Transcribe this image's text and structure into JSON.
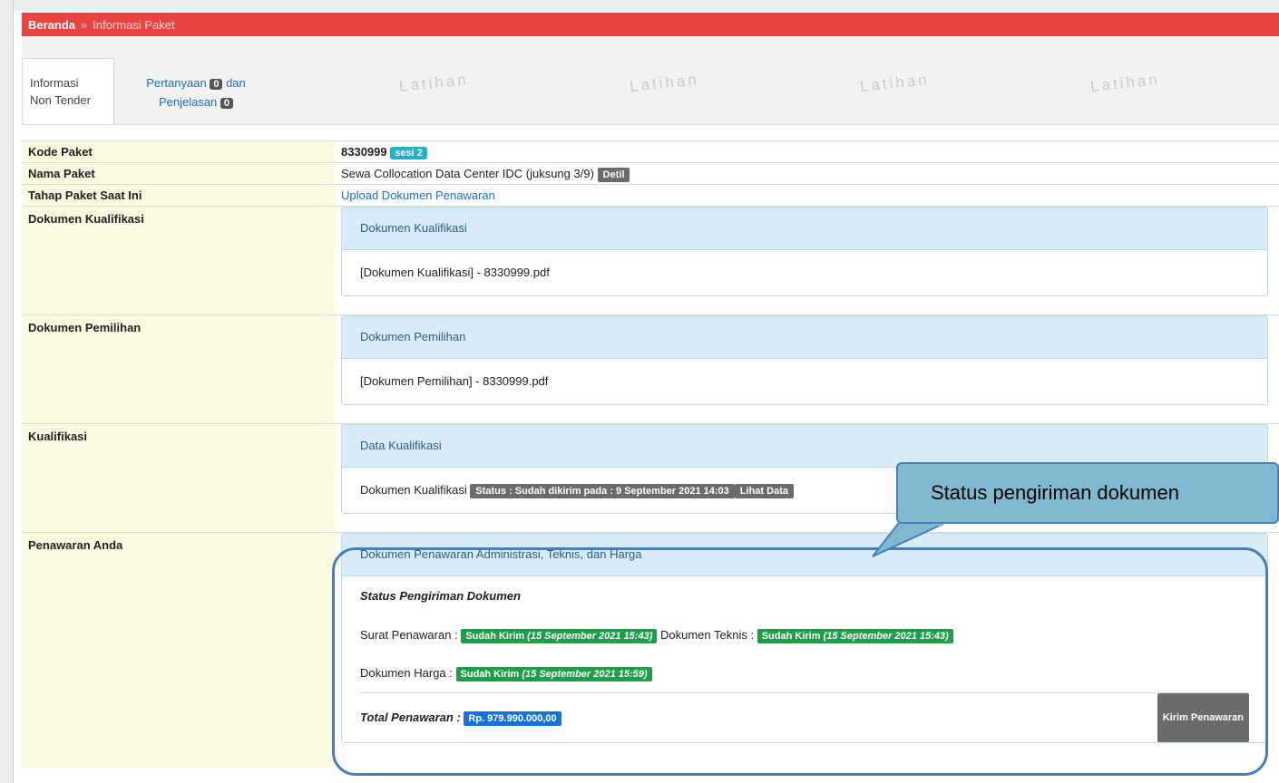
{
  "breadcrumb": {
    "home": "Beranda",
    "separator": "»",
    "current": "Informasi Paket"
  },
  "tabs": {
    "active_line1": "Informasi",
    "active_line2": "Non Tender",
    "qa_part1": "Pertanyaan",
    "qa_count": "0",
    "qa_part2": "dan",
    "qa_part3": "Penjelasan",
    "qa_count2": "0"
  },
  "watermark": "Latihan",
  "rows": {
    "kode_label": "Kode Paket",
    "kode_value": "8330999",
    "kode_badge": "sesi 2",
    "nama_label": "Nama Paket",
    "nama_value": "Sewa Collocation Data Center IDC (juksung 3/9)",
    "nama_badge": "Detil",
    "tahap_label": "Tahap Paket Saat Ini",
    "tahap_value": "Upload Dokumen Penawaran",
    "dok_kual_label": "Dokumen Kualifikasi",
    "dok_kual_panel_title": "Dokumen Kualifikasi",
    "dok_kual_file": "[Dokumen Kualifikasi] - 8330999.pdf",
    "dok_pemilihan_label": "Dokumen Pemilihan",
    "dok_pemilihan_panel_title": "Dokumen Pemilihan",
    "dok_pemilihan_file": "[Dokumen Pemilihan] - 8330999.pdf",
    "kualifikasi_label": "Kualifikasi",
    "kualifikasi_panel_title": "Data Kualifikasi",
    "kualifikasi_item": "Dokumen Kualifikasi",
    "kualifikasi_status": "Status : Sudah dikirim pada : 9 September 2021 14:03",
    "kualifikasi_lihat": "Lihat Data",
    "penawaran_label": "Penawaran Anda"
  },
  "penawaran": {
    "panel_title": "Dokumen Penawaran Administrasi, Teknis, dan Harga",
    "status_heading": "Status Pengiriman Dokumen",
    "surat_label": "Surat Penawaran :",
    "surat_status": "Sudah Kirim",
    "surat_time": "(15 September 2021 15:43)",
    "teknis_label": "Dokumen Teknis :",
    "teknis_status": "Sudah Kirim",
    "teknis_time": "(15 September 2021 15:43)",
    "harga_label": "Dokumen Harga :",
    "harga_status": "Sudah Kirim",
    "harga_time": "(15 September 2021 15:59)",
    "total_label": "Total Penawaran :",
    "total_value": "Rp. 979.990.000,00",
    "kirim_button": "Kirim Penawaran"
  },
  "callout": {
    "text": "Status pengiriman dokumen"
  },
  "colors": {
    "header_red": "#e84542",
    "label_bg": "#fafae0",
    "panel_blue": "#d8ecf7",
    "success_green": "#1e9e4a",
    "primary_blue": "#1672d6",
    "callout_bg": "#7fb8cf"
  }
}
